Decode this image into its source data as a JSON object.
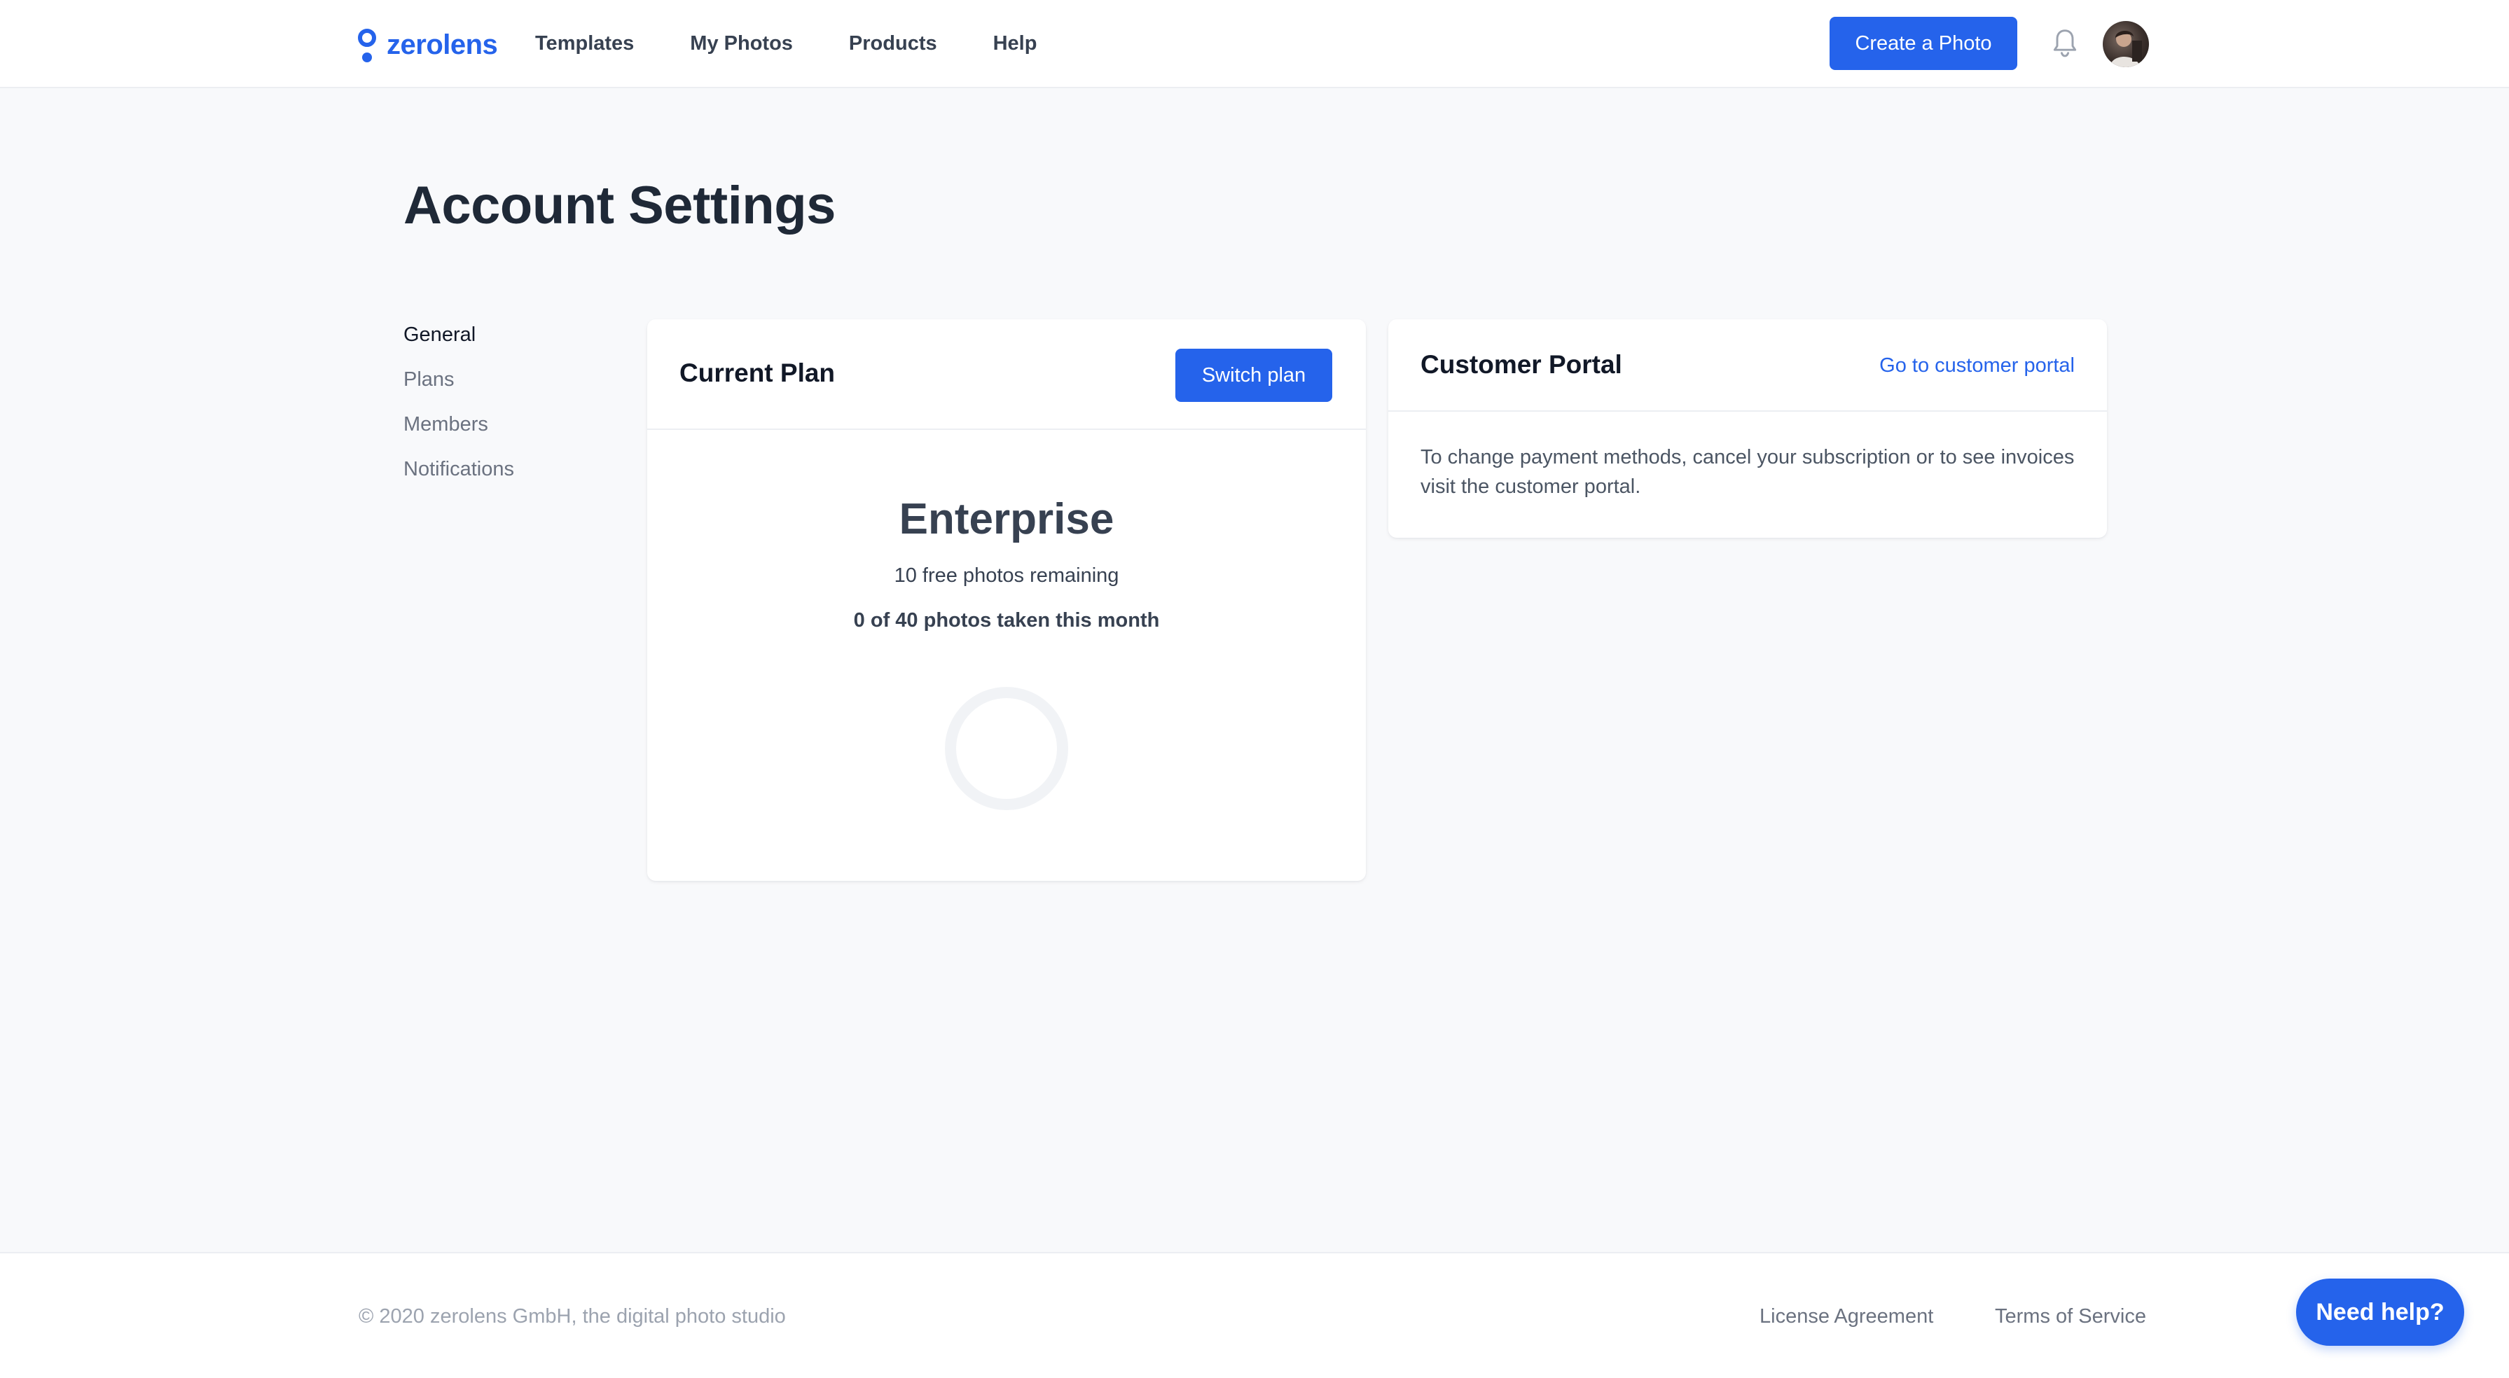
{
  "header": {
    "brand": "zerolens",
    "nav": [
      "Templates",
      "My Photos",
      "Products",
      "Help"
    ],
    "create_button": "Create a Photo"
  },
  "page": {
    "title": "Account Settings"
  },
  "side_menu": {
    "items": [
      "General",
      "Plans",
      "Members",
      "Notifications"
    ],
    "active": "General"
  },
  "current_plan": {
    "title": "Current Plan",
    "switch_button": "Switch plan",
    "plan_name": "Enterprise",
    "free_remaining": "10 free photos remaining",
    "usage_text": "0 of 40 photos taken this month",
    "usage_fraction": 0
  },
  "customer_portal": {
    "title": "Customer Portal",
    "link": "Go to customer portal",
    "description": "To change payment methods, cancel your subscription or to see invoices visit the customer portal."
  },
  "footer": {
    "copyright": "© 2020 zerolens GmbH, the digital photo studio",
    "links": [
      "License Agreement",
      "Terms of Service"
    ]
  },
  "help_button": "Need help?",
  "colors": {
    "accent": "#2563eb",
    "ring_track": "#f1f3f6"
  }
}
